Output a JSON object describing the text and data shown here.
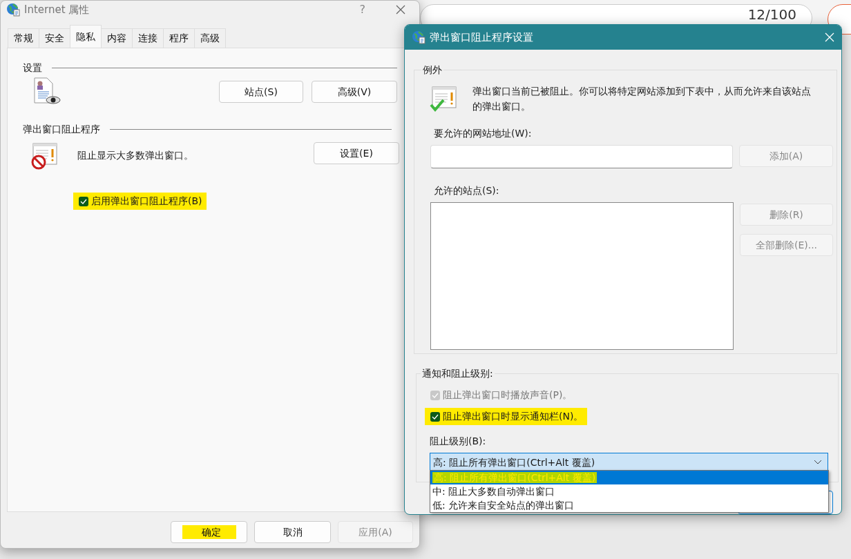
{
  "background_page": {
    "counter": "12/100"
  },
  "internet_properties": {
    "title": "Internet 属性",
    "help": "?",
    "tabs": [
      {
        "label": "常规",
        "selected": false
      },
      {
        "label": "安全",
        "selected": false
      },
      {
        "label": "隐私",
        "selected": true
      },
      {
        "label": "内容",
        "selected": false
      },
      {
        "label": "连接",
        "selected": false
      },
      {
        "label": "程序",
        "selected": false
      },
      {
        "label": "高级",
        "selected": false
      }
    ],
    "settings_section": {
      "heading": "设置",
      "buttons": [
        "站点(S)",
        "高级(V)"
      ]
    },
    "popup_section": {
      "heading": "弹出窗口阻止程序",
      "description": "阻止显示大多数弹出窗口。",
      "settings_button": "设置(E)",
      "checkbox": {
        "label": "启用弹出窗口阻止程序(B)",
        "checked": true,
        "highlighted": true
      }
    },
    "footer_buttons": [
      {
        "label": "确定",
        "disabled": false,
        "highlighted": true
      },
      {
        "label": "取消",
        "disabled": false,
        "highlighted": false
      },
      {
        "label": "应用(A)",
        "disabled": true,
        "highlighted": false
      }
    ]
  },
  "popup_settings": {
    "title": "弹出窗口阻止程序设置",
    "exceptions": {
      "heading": "例外",
      "description": "弹出窗口当前已被阻止。你可以将特定网站添加到下表中，从而允许来自该站点的弹出窗口。",
      "address_label": "要允许的网站地址(W):",
      "add_button": {
        "label": "添加(A)",
        "disabled": true
      },
      "allowed_label": "允许的站点(S):",
      "list_buttons": [
        {
          "label": "删除(R)",
          "disabled": true
        },
        {
          "label": "全部删除(E)...",
          "disabled": true
        }
      ]
    },
    "notifications": {
      "heading": "通知和阻止级别:",
      "options": [
        {
          "label": "阻止弹出窗口时播放声音(P)。",
          "checked": true,
          "disabled": true,
          "highlighted": false
        },
        {
          "label": "阻止弹出窗口时显示通知栏(N)。",
          "checked": true,
          "disabled": false,
          "highlighted": true
        }
      ],
      "level_label": "阻止级别(B):",
      "level_value": "高: 阻止所有弹出窗口(Ctrl+Alt 覆盖)",
      "level_options": [
        {
          "label": "高: 阻止所有弹出窗口(Ctrl+Alt 覆盖)",
          "selected": true,
          "highlighted": true
        },
        {
          "label": "中: 阻止大多数自动弹出窗口",
          "selected": false,
          "highlighted": false
        },
        {
          "label": "低: 允许来自安全站点的弹出窗口",
          "selected": false,
          "highlighted": false
        }
      ]
    }
  }
}
